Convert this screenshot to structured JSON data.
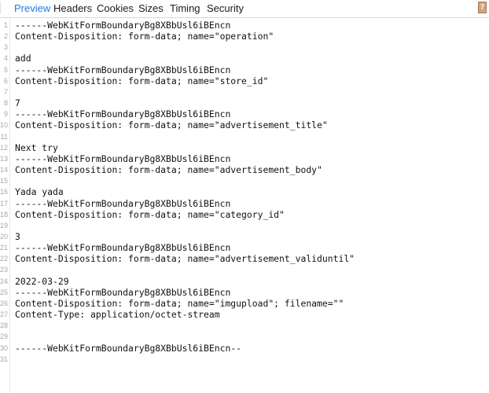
{
  "tabs": [
    {
      "label": "Preview",
      "active": true
    },
    {
      "label": "Headers",
      "active": false
    },
    {
      "label": "Cookies",
      "active": false
    },
    {
      "label": "Sizes",
      "active": false
    },
    {
      "label": "Timing",
      "active": false
    },
    {
      "label": "Security",
      "active": false
    }
  ],
  "help_icon": {
    "glyph": "?",
    "icon": "help-icon"
  },
  "body_lines": [
    "------WebKitFormBoundaryBg8XBbUsl6iBEncn",
    "Content-Disposition: form-data; name=\"operation\"",
    "",
    "add",
    "------WebKitFormBoundaryBg8XBbUsl6iBEncn",
    "Content-Disposition: form-data; name=\"store_id\"",
    "",
    "7",
    "------WebKitFormBoundaryBg8XBbUsl6iBEncn",
    "Content-Disposition: form-data; name=\"advertisement_title\"",
    "",
    "Next try",
    "------WebKitFormBoundaryBg8XBbUsl6iBEncn",
    "Content-Disposition: form-data; name=\"advertisement_body\"",
    "",
    "Yada yada",
    "------WebKitFormBoundaryBg8XBbUsl6iBEncn",
    "Content-Disposition: form-data; name=\"category_id\"",
    "",
    "3",
    "------WebKitFormBoundaryBg8XBbUsl6iBEncn",
    "Content-Disposition: form-data; name=\"advertisement_validuntil\"",
    "",
    "2022-03-29",
    "------WebKitFormBoundaryBg8XBbUsl6iBEncn",
    "Content-Disposition: form-data; name=\"imgupload\"; filename=\"\"",
    "Content-Type: application/octet-stream",
    "",
    "",
    "------WebKitFormBoundaryBg8XBbUsl6iBEncn--",
    ""
  ],
  "colors": {
    "active_tab": "#1f7ae6",
    "line_number": "#a8a8a8",
    "text": "#111111"
  }
}
